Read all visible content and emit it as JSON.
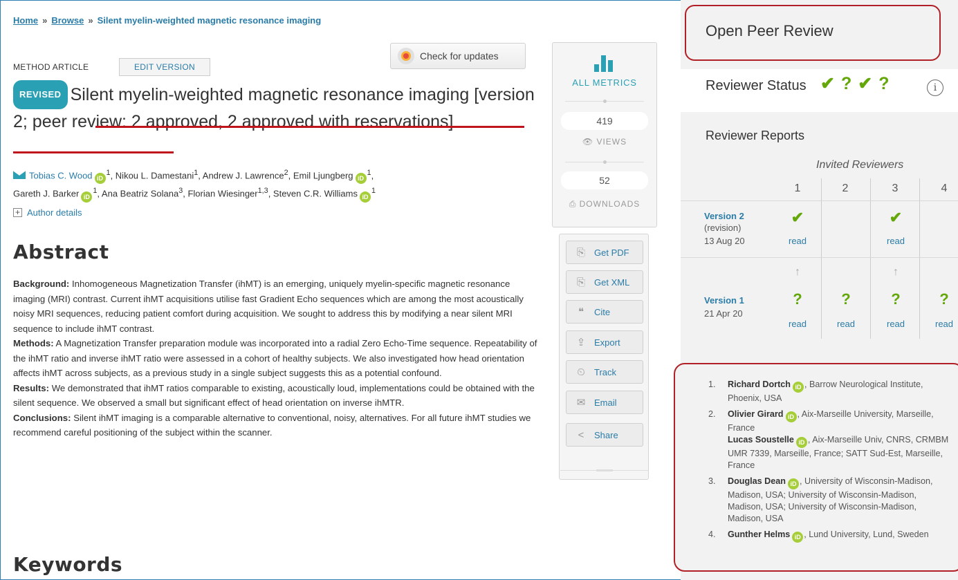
{
  "breadcrumb": {
    "home": "Home",
    "sep": "»",
    "browse": "Browse",
    "current": "Silent myelin-weighted magnetic resonance imaging"
  },
  "check_updates": "Check for updates",
  "article": {
    "type": "METHOD ARTICLE",
    "edit_version": "EDIT VERSION",
    "badge": "REVISED",
    "title_main": "Silent myelin-weighted magnetic resonance imaging ",
    "title_status": "[version 2; peer review: 2 approved, 2 approved with reservations]",
    "authors": {
      "a1": "Tobias C. Wood",
      "a1_aff": "1",
      "a2": ", Nikou L. Damestani",
      "a2_aff": "1",
      "a3": ", Andrew J. Lawrence",
      "a3_aff": "2",
      "a4": ", Emil Ljungberg",
      "a4_aff": "1",
      "a5": "Gareth J. Barker",
      "a5_aff": "1",
      "a6": ", Ana Beatriz Solana",
      "a6_aff": "3",
      "a7": ", Florian Wiesinger",
      "a7_aff": "1,3",
      "a8": ", Steven C.R. Williams",
      "a8_aff": "1"
    },
    "orcid_label": "iD",
    "author_details": "Author details",
    "abstract_heading": "Abstract",
    "abstract": {
      "bg_label": "Background:",
      "bg_text": " Inhomogeneous Magnetization Transfer (ihMT) is an emerging, uniquely myelin-specific magnetic resonance imaging (MRI) contrast. Current ihMT acquisitions utilise fast Gradient Echo sequences which are among the most acoustically noisy MRI sequences, reducing patient comfort during acquisition. We sought to address this by modifying a near silent MRI sequence to include ihMT contrast.",
      "methods_label": "Methods:",
      "methods_text": " A Magnetization Transfer preparation module was incorporated into a radial Zero Echo-Time sequence. Repeatability of the ihMT ratio and inverse ihMT ratio were assessed in a cohort of healthy subjects. We also investigated how head orientation affects ihMT across subjects, as a previous study in a single subject suggests this as a potential confound.",
      "results_label": "Results:",
      "results_text": " We demonstrated that ihMT ratios comparable to existing, acoustically loud, implementations could be obtained with the silent sequence. We observed a small but significant effect of head orientation on inverse ihMTR.",
      "conclusions_label": "Conclusions:",
      "conclusions_text": " Silent ihMT imaging is a comparable alternative to conventional, noisy, alternatives. For all future ihMT studies we recommend careful positioning of the subject within the scanner."
    },
    "keywords_heading": "Keywords"
  },
  "metrics": {
    "all_metrics": "ALL METRICS",
    "views_count": "419",
    "views_label": "VIEWS",
    "downloads_count": "52",
    "downloads_label": "DOWNLOADS"
  },
  "actions": [
    {
      "label": "Get PDF",
      "icon": "pdf-icon"
    },
    {
      "label": "Get XML",
      "icon": "xml-icon"
    },
    {
      "label": "Cite",
      "icon": "quote-icon"
    },
    {
      "label": "Export",
      "icon": "export-icon"
    },
    {
      "label": "Track",
      "icon": "clock-icon"
    },
    {
      "label": "Email",
      "icon": "mail-icon"
    },
    {
      "label": "Share",
      "icon": "share-icon"
    }
  ],
  "peer_review": {
    "title": "Open Peer Review",
    "status_label": "Reviewer Status",
    "status_marks": [
      "✔",
      "?",
      "✔",
      "?"
    ],
    "info": "i",
    "reports_title": "Reviewer Reports",
    "invited": "Invited Reviewers",
    "columns": [
      "1",
      "2",
      "3",
      "4"
    ],
    "versions": [
      {
        "label": "Version 2",
        "sub1": "(revision)",
        "sub2": "13 Aug 20",
        "marks": [
          "✔",
          "",
          "✔",
          ""
        ],
        "read": [
          "read",
          "",
          "read",
          ""
        ]
      },
      {
        "label": "Version 1",
        "sub1": "21 Apr 20",
        "sub2": "",
        "marks": [
          "?",
          "?",
          "?",
          "?"
        ],
        "read": [
          "read",
          "read",
          "read",
          "read"
        ]
      }
    ],
    "up_arrow": "↑",
    "reviewers": [
      {
        "num": "1.",
        "name": "Richard Dortch",
        "aff": ", Barrow Neurological Institute, Phoenix, USA"
      },
      {
        "num": "2.",
        "name": "Olivier Girard",
        "aff": ", Aix-Marseille University, Marseille, France",
        "co_name": "Lucas Soustelle",
        "co_aff": ", Aix-Marseille Univ, CNRS, CRMBM UMR 7339, Marseille, France; SATT Sud-Est, Marseille, France"
      },
      {
        "num": "3.",
        "name": "Douglas Dean",
        "aff": ", University of Wisconsin-Madison, Madison, USA; University of Wisconsin-Madison, Madison, USA; University of Wisconsin-Madison, Madison, USA"
      },
      {
        "num": "4.",
        "name": "Gunther Helms",
        "aff": ", Lund University, Lund, Sweden"
      }
    ]
  },
  "colors": {
    "accent": "#2aa0b5",
    "link": "#2a7ca8",
    "approved": "#64a70b",
    "reservations": "#64a70b",
    "highlight": "#c0141c",
    "orcid": "#a6ce39"
  }
}
